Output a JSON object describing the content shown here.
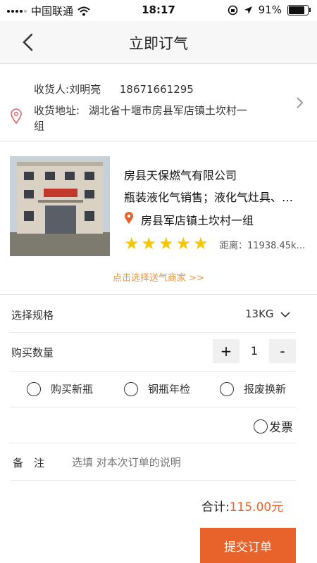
{
  "status_bar": {
    "carrier": "中国联通",
    "time": "18:17",
    "battery": "91%",
    "battery_level": 0.91
  },
  "nav": {
    "title": "立即订气"
  },
  "address": {
    "recipient_label": "收货人:",
    "recipient_name": "刘明亮",
    "phone": "18671661295",
    "address_label": "收货地址:",
    "address_line1": "湖北省十堰市房县军店镇土坎村一",
    "address_line2": "组"
  },
  "shop": {
    "name": "房县天保燃气有限公司",
    "services": "瓶装液化气销售；液化气灶具、…",
    "location": "房县军店镇土坎村一组",
    "rating": 5,
    "distance": "距离：11938.45k…",
    "select_link": "点击选择送气商家 >>"
  },
  "spec": {
    "label": "选择规格",
    "value": "13KG"
  },
  "quantity": {
    "label": "购买数量",
    "plus": "+",
    "value": "1",
    "minus": "-"
  },
  "options": [
    "购买新瓶",
    "钢瓶年检",
    "报废换新"
  ],
  "invoice": {
    "label": "发票"
  },
  "remark": {
    "label": "备　注",
    "placeholder": "选填 对本次订单的说明"
  },
  "total": {
    "label": "合计:",
    "amount": "115.00元"
  },
  "submit": {
    "label": "提交订单"
  },
  "colors": {
    "accent": "#e8632b",
    "star": "#f5c600",
    "link": "#e8943a",
    "price": "#e8632b"
  }
}
